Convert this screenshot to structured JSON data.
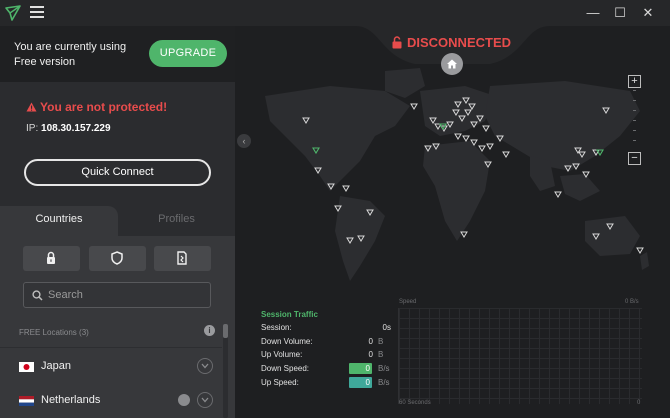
{
  "header": {
    "minimize": "—",
    "maximize": "☐",
    "close": "✕"
  },
  "account": {
    "free_text_line1": "You are currently using",
    "free_text_line2": "Free version",
    "upgrade_label": "UPGRADE"
  },
  "protection": {
    "warning": "You are not protected!",
    "ip_label": "IP:",
    "ip_value": "108.30.157.229",
    "quick_connect": "Quick Connect"
  },
  "tabs": {
    "countries": "Countries",
    "profiles": "Profiles"
  },
  "search": {
    "placeholder": "Search"
  },
  "locations": {
    "header": "FREE Locations (3)",
    "items": [
      {
        "name": "Japan"
      },
      {
        "name": "Netherlands"
      }
    ]
  },
  "status": {
    "label": "DISCONNECTED",
    "color": "#e84c4c"
  },
  "zoom": {
    "in": "+",
    "out": "−"
  },
  "traffic": {
    "title": "Session Traffic",
    "session_label": "Session:",
    "session_value": "0s",
    "down_volume_label": "Down Volume:",
    "down_volume_value": "0",
    "down_volume_unit": "B",
    "up_volume_label": "Up Volume:",
    "up_volume_value": "0",
    "up_volume_unit": "B",
    "down_speed_label": "Down Speed:",
    "down_speed_value": "0",
    "down_speed_unit": "B/s",
    "up_speed_label": "Up Speed:",
    "up_speed_value": "0",
    "up_speed_unit": "B/s"
  },
  "graph": {
    "speed_label": "Speed",
    "max_label": "0  B/s",
    "seconds_label": "60 Seconds",
    "zero_label": "0"
  },
  "colors": {
    "accent_green": "#4fb56b",
    "danger_red": "#e84c4c",
    "up_speed_teal": "#3fa89a"
  }
}
